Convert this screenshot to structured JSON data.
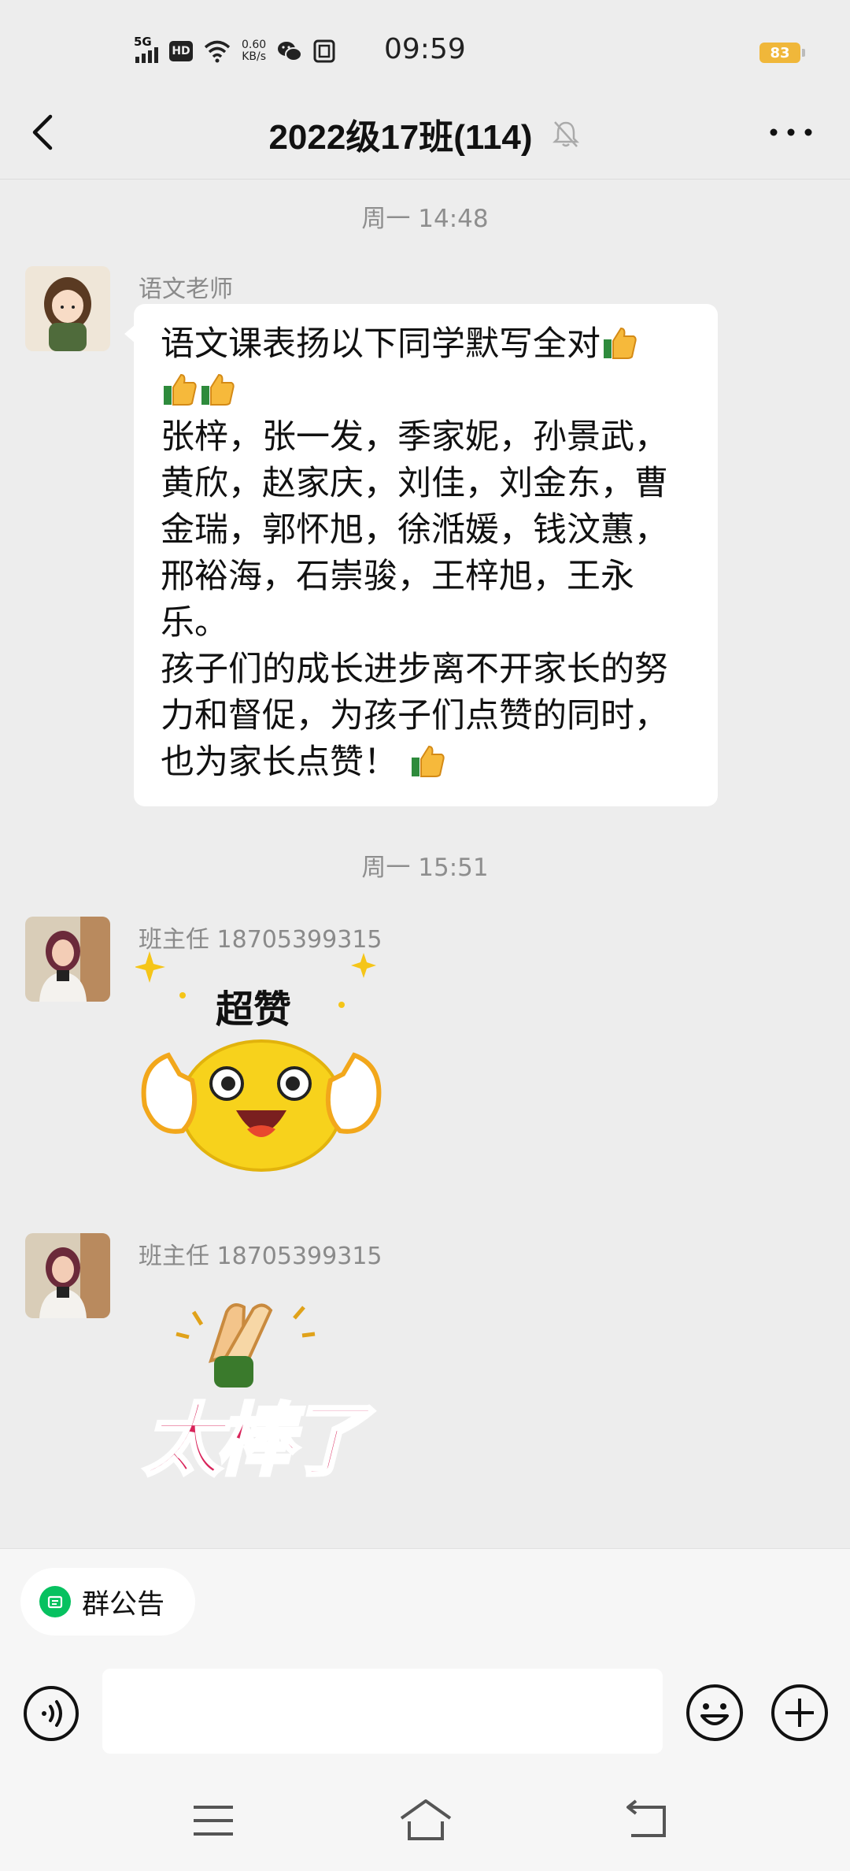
{
  "status_bar": {
    "network_type": "5G",
    "hd_label": "HD",
    "net_speed_value": "0.60",
    "net_speed_unit": "KB/s",
    "time": "09:59",
    "battery": "83"
  },
  "header": {
    "title": "2022级17班(114)",
    "muted": true
  },
  "messages": [
    {
      "time_label": "周一 14:48",
      "sender": "语文老师",
      "lines": [
        "语文课表扬以下同学默写全对",
        "",
        "张梓，张一发，季家妮，孙景武，",
        "黄欣，赵家庆，刘佳，刘金东，曹",
        "金瑞，郭怀旭，徐湉媛，钱汶蕙，",
        "邢裕海，石崇骏，王梓旭，王永",
        "乐。",
        "孩子们的成长进步离不开家长的努",
        "力和督促，为孩子们点赞的同时，",
        "也为家长点赞！"
      ]
    },
    {
      "time_label": "周一 15:51",
      "sender": "班主任 18705399315",
      "sticker_text": "超赞"
    },
    {
      "sender": "班主任 18705399315",
      "sticker_text": "太棒了"
    }
  ],
  "input_area": {
    "notice_label": "群公告",
    "input_value": ""
  },
  "colors": {
    "background": "#ededed",
    "accent_green": "#07c160",
    "battery": "#f0b73a",
    "sticker_red": "#d8245a",
    "sticker_yellow": "#f7d21c"
  }
}
